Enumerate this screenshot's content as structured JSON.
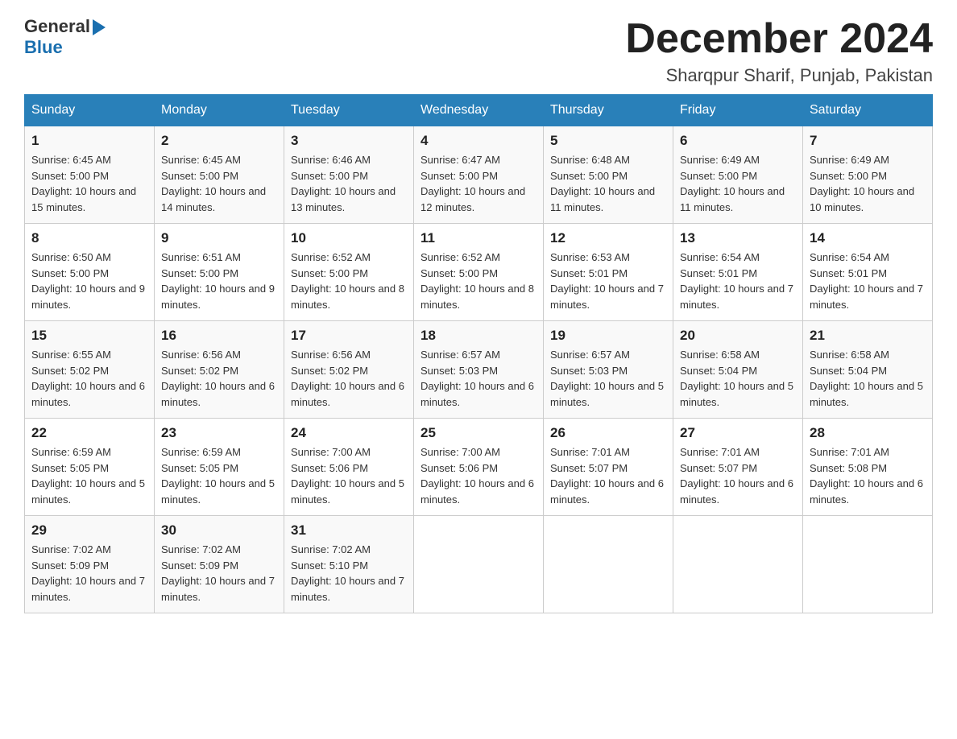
{
  "header": {
    "logo_general": "General",
    "logo_blue": "Blue",
    "month_title": "December 2024",
    "location": "Sharqpur Sharif, Punjab, Pakistan"
  },
  "days_of_week": [
    "Sunday",
    "Monday",
    "Tuesday",
    "Wednesday",
    "Thursday",
    "Friday",
    "Saturday"
  ],
  "weeks": [
    [
      {
        "day": "1",
        "sunrise": "6:45 AM",
        "sunset": "5:00 PM",
        "daylight": "10 hours and 15 minutes."
      },
      {
        "day": "2",
        "sunrise": "6:45 AM",
        "sunset": "5:00 PM",
        "daylight": "10 hours and 14 minutes."
      },
      {
        "day": "3",
        "sunrise": "6:46 AM",
        "sunset": "5:00 PM",
        "daylight": "10 hours and 13 minutes."
      },
      {
        "day": "4",
        "sunrise": "6:47 AM",
        "sunset": "5:00 PM",
        "daylight": "10 hours and 12 minutes."
      },
      {
        "day": "5",
        "sunrise": "6:48 AM",
        "sunset": "5:00 PM",
        "daylight": "10 hours and 11 minutes."
      },
      {
        "day": "6",
        "sunrise": "6:49 AM",
        "sunset": "5:00 PM",
        "daylight": "10 hours and 11 minutes."
      },
      {
        "day": "7",
        "sunrise": "6:49 AM",
        "sunset": "5:00 PM",
        "daylight": "10 hours and 10 minutes."
      }
    ],
    [
      {
        "day": "8",
        "sunrise": "6:50 AM",
        "sunset": "5:00 PM",
        "daylight": "10 hours and 9 minutes."
      },
      {
        "day": "9",
        "sunrise": "6:51 AM",
        "sunset": "5:00 PM",
        "daylight": "10 hours and 9 minutes."
      },
      {
        "day": "10",
        "sunrise": "6:52 AM",
        "sunset": "5:00 PM",
        "daylight": "10 hours and 8 minutes."
      },
      {
        "day": "11",
        "sunrise": "6:52 AM",
        "sunset": "5:00 PM",
        "daylight": "10 hours and 8 minutes."
      },
      {
        "day": "12",
        "sunrise": "6:53 AM",
        "sunset": "5:01 PM",
        "daylight": "10 hours and 7 minutes."
      },
      {
        "day": "13",
        "sunrise": "6:54 AM",
        "sunset": "5:01 PM",
        "daylight": "10 hours and 7 minutes."
      },
      {
        "day": "14",
        "sunrise": "6:54 AM",
        "sunset": "5:01 PM",
        "daylight": "10 hours and 7 minutes."
      }
    ],
    [
      {
        "day": "15",
        "sunrise": "6:55 AM",
        "sunset": "5:02 PM",
        "daylight": "10 hours and 6 minutes."
      },
      {
        "day": "16",
        "sunrise": "6:56 AM",
        "sunset": "5:02 PM",
        "daylight": "10 hours and 6 minutes."
      },
      {
        "day": "17",
        "sunrise": "6:56 AM",
        "sunset": "5:02 PM",
        "daylight": "10 hours and 6 minutes."
      },
      {
        "day": "18",
        "sunrise": "6:57 AM",
        "sunset": "5:03 PM",
        "daylight": "10 hours and 6 minutes."
      },
      {
        "day": "19",
        "sunrise": "6:57 AM",
        "sunset": "5:03 PM",
        "daylight": "10 hours and 5 minutes."
      },
      {
        "day": "20",
        "sunrise": "6:58 AM",
        "sunset": "5:04 PM",
        "daylight": "10 hours and 5 minutes."
      },
      {
        "day": "21",
        "sunrise": "6:58 AM",
        "sunset": "5:04 PM",
        "daylight": "10 hours and 5 minutes."
      }
    ],
    [
      {
        "day": "22",
        "sunrise": "6:59 AM",
        "sunset": "5:05 PM",
        "daylight": "10 hours and 5 minutes."
      },
      {
        "day": "23",
        "sunrise": "6:59 AM",
        "sunset": "5:05 PM",
        "daylight": "10 hours and 5 minutes."
      },
      {
        "day": "24",
        "sunrise": "7:00 AM",
        "sunset": "5:06 PM",
        "daylight": "10 hours and 5 minutes."
      },
      {
        "day": "25",
        "sunrise": "7:00 AM",
        "sunset": "5:06 PM",
        "daylight": "10 hours and 6 minutes."
      },
      {
        "day": "26",
        "sunrise": "7:01 AM",
        "sunset": "5:07 PM",
        "daylight": "10 hours and 6 minutes."
      },
      {
        "day": "27",
        "sunrise": "7:01 AM",
        "sunset": "5:07 PM",
        "daylight": "10 hours and 6 minutes."
      },
      {
        "day": "28",
        "sunrise": "7:01 AM",
        "sunset": "5:08 PM",
        "daylight": "10 hours and 6 minutes."
      }
    ],
    [
      {
        "day": "29",
        "sunrise": "7:02 AM",
        "sunset": "5:09 PM",
        "daylight": "10 hours and 7 minutes."
      },
      {
        "day": "30",
        "sunrise": "7:02 AM",
        "sunset": "5:09 PM",
        "daylight": "10 hours and 7 minutes."
      },
      {
        "day": "31",
        "sunrise": "7:02 AM",
        "sunset": "5:10 PM",
        "daylight": "10 hours and 7 minutes."
      },
      null,
      null,
      null,
      null
    ]
  ],
  "labels": {
    "sunrise_prefix": "Sunrise: ",
    "sunset_prefix": "Sunset: ",
    "daylight_prefix": "Daylight: "
  }
}
